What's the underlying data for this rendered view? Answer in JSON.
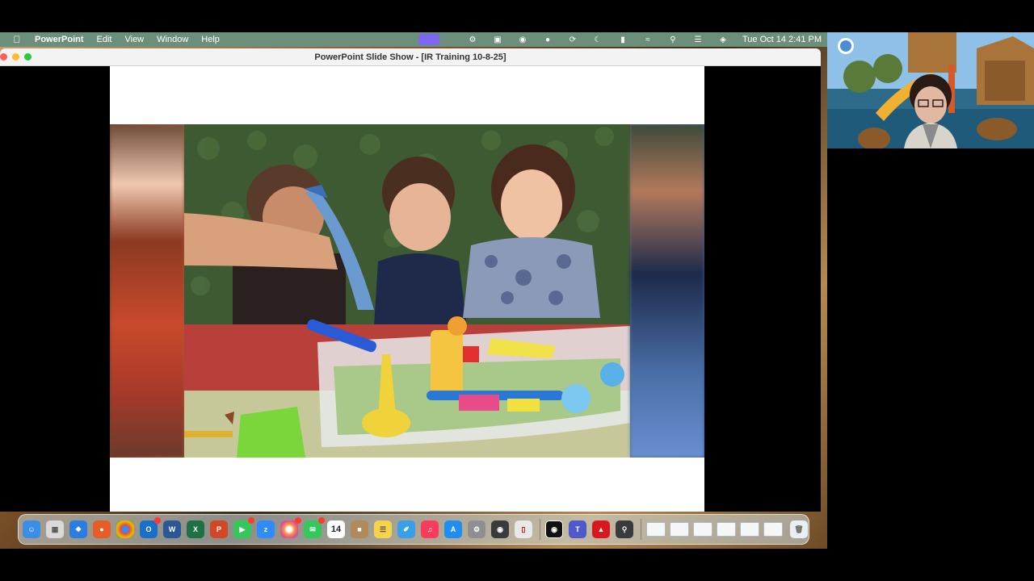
{
  "menubar": {
    "app_name": "PowerPoint",
    "menus": [
      "Edit",
      "View",
      "Window",
      "Help"
    ],
    "clock": "Tue Oct 14  2:41 PM",
    "status_icons": [
      "screen-share-icon",
      "tools-icon",
      "display-icon",
      "copilot-icon",
      "record-icon",
      "sync-icon",
      "moon-icon",
      "battery-icon",
      "wifi-icon",
      "search-icon",
      "control-center-icon",
      "siri-icon"
    ]
  },
  "window": {
    "title": "PowerPoint Slide Show - [IR Training 10-8-25]"
  },
  "dock": {
    "apps": [
      {
        "name": "finder-icon",
        "color": "#3a8ee6"
      },
      {
        "name": "launchpad-icon",
        "color": "#e8e8e8"
      },
      {
        "name": "safari-icon",
        "color": "#2a7de1"
      },
      {
        "name": "firefox-icon",
        "color": "#e85d27"
      },
      {
        "name": "chrome-icon",
        "color": "#e0453a"
      },
      {
        "name": "outlook-icon",
        "color": "#1a6fc9"
      },
      {
        "name": "word-icon",
        "color": "#2b5797"
      },
      {
        "name": "excel-icon",
        "color": "#1e7145"
      },
      {
        "name": "powerpoint-icon",
        "color": "#d24726"
      },
      {
        "name": "facetime-icon",
        "color": "#34c759"
      },
      {
        "name": "zoom-icon",
        "color": "#2d8cff"
      },
      {
        "name": "photos-icon",
        "color": "#f2994a"
      },
      {
        "name": "messages-icon",
        "color": "#34c759"
      },
      {
        "name": "calendar-icon",
        "color": "#ffffff"
      },
      {
        "name": "contacts-icon",
        "color": "#b08a5a"
      },
      {
        "name": "notes-icon",
        "color": "#f7d34a"
      },
      {
        "name": "freeform-icon",
        "color": "#3aa0e6"
      },
      {
        "name": "music-icon",
        "color": "#fa3c5a"
      },
      {
        "name": "app-store-icon",
        "color": "#1f8ef1"
      },
      {
        "name": "system-settings-icon",
        "color": "#8e8e93"
      },
      {
        "name": "camera-icon",
        "color": "#3a3a3c"
      },
      {
        "name": "remote-desktop-icon",
        "color": "#e8e8e8"
      },
      {
        "name": "teams-icon",
        "color": "#5059c9"
      },
      {
        "name": "acrobat-icon",
        "color": "#d7191f"
      },
      {
        "name": "screen-capture-icon",
        "color": "#3a3a3c"
      }
    ],
    "calendar_day": "14"
  }
}
